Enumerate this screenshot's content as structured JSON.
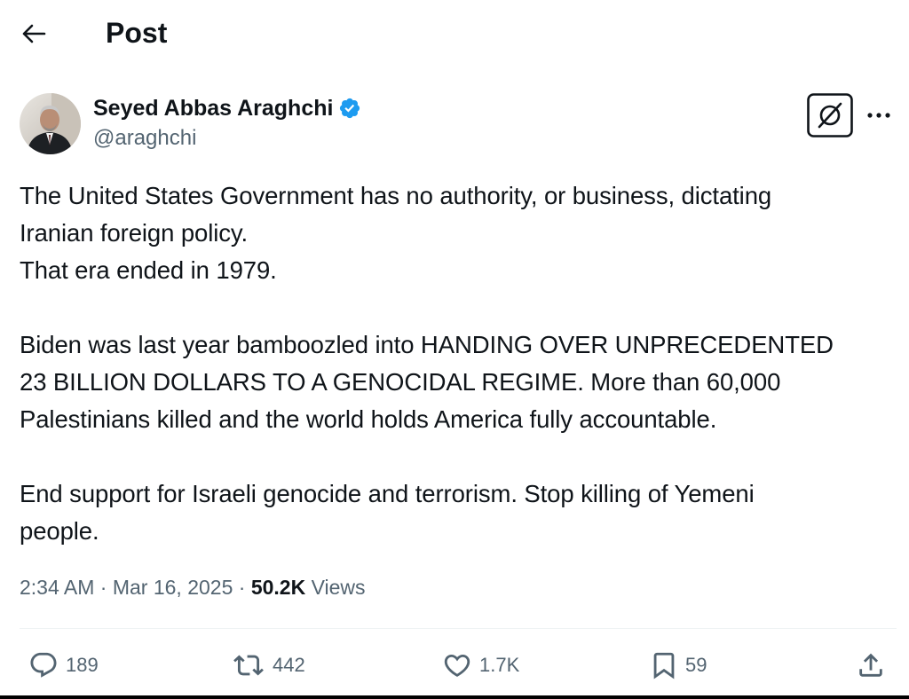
{
  "header": {
    "title": "Post",
    "back_icon": "arrow-left-icon"
  },
  "author": {
    "display_name": "Seyed Abbas Araghchi",
    "handle": "@araghchi",
    "verified": true,
    "verified_color": "#1d9bf0",
    "grok_icon": "grok-icon",
    "more_icon": "more-horizontal-icon"
  },
  "tweet": {
    "text": "The United States Government has no authority, or business, dictating\nIranian foreign policy.\nThat era ended in 1979.\n\nBiden was last year bamboozled into HANDING OVER UNPRECEDENTED\n23 BILLION DOLLARS TO A GENOCIDAL REGIME. More than 60,000\nPalestinians killed and the world holds America fully accountable.\n\nEnd support for Israeli genocide and terrorism. Stop killing of Yemeni\npeople."
  },
  "meta": {
    "time": "2:34 AM",
    "separator": "·",
    "date": "Mar 16, 2025",
    "views_count": "50.2K",
    "views_label": "Views"
  },
  "actions": {
    "replies": "189",
    "reposts": "442",
    "likes": "1.7K",
    "bookmarks": "59"
  },
  "colors": {
    "text": "#0f1419",
    "secondary": "#536471",
    "divider": "#eff3f4",
    "accent": "#1d9bf0"
  }
}
